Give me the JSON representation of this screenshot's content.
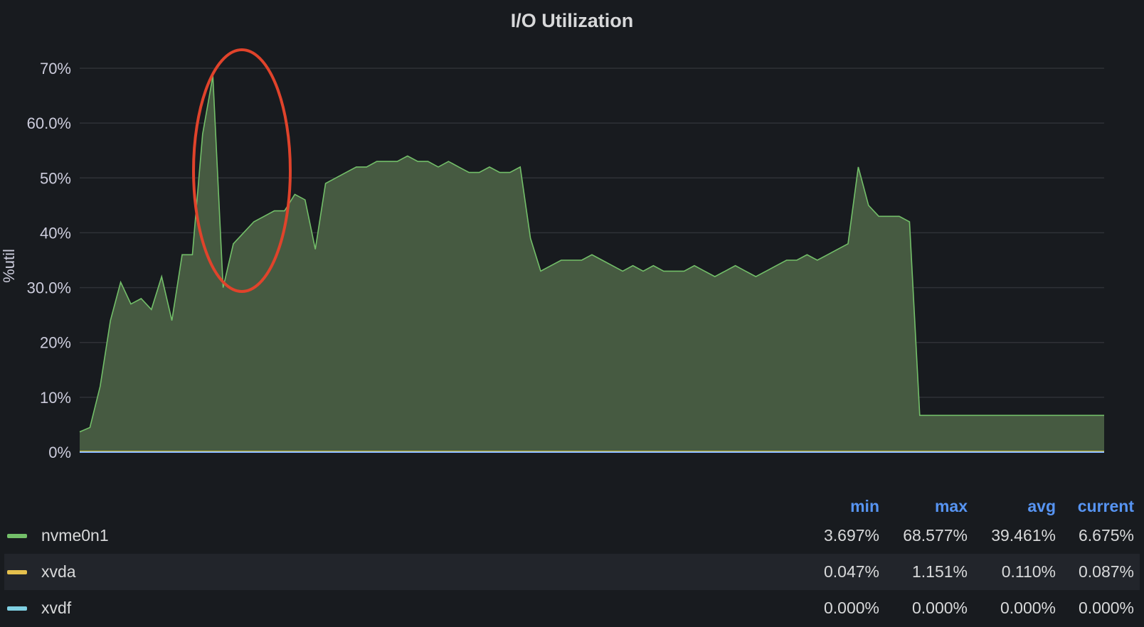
{
  "panel": {
    "title": "I/O Utilization"
  },
  "chart_data": {
    "type": "area",
    "title": "I/O Utilization",
    "ylabel": "%util",
    "ylim": [
      0,
      70
    ],
    "yticks": [
      {
        "value": 0,
        "label": "0%"
      },
      {
        "value": 10,
        "label": "10%"
      },
      {
        "value": 20,
        "label": "20%"
      },
      {
        "value": 30,
        "label": "30.0%"
      },
      {
        "value": 40,
        "label": "40%"
      },
      {
        "value": 50,
        "label": "50%"
      },
      {
        "value": 60,
        "label": "60.0%"
      },
      {
        "value": 70,
        "label": "70%"
      }
    ],
    "grid": true,
    "legend_placement": "bottom",
    "series": [
      {
        "name": "nvme0n1",
        "color": "#73bf69",
        "fill": "#465a41",
        "x": [
          0,
          1,
          2,
          3,
          4,
          5,
          6,
          7,
          8,
          9,
          10,
          11,
          12,
          13,
          14,
          15,
          16,
          17,
          18,
          19,
          20,
          21,
          22,
          23,
          24,
          25,
          26,
          27,
          28,
          29,
          30,
          31,
          32,
          33,
          34,
          35,
          36,
          37,
          38,
          39,
          40,
          41,
          42,
          43,
          44,
          45,
          46,
          47,
          48,
          49,
          50,
          51,
          52,
          53,
          54,
          55,
          56,
          57,
          58,
          59,
          60,
          61,
          62,
          63,
          64,
          65,
          66,
          67,
          68,
          69,
          70,
          71,
          72,
          73,
          74,
          75,
          76,
          77,
          78,
          79,
          80,
          81,
          82,
          83,
          84,
          85,
          86,
          87,
          88,
          89,
          90,
          91,
          92,
          93,
          94,
          95,
          96,
          97,
          98,
          99,
          100
        ],
        "values": [
          3.7,
          4.5,
          12,
          24,
          31,
          27,
          28,
          26,
          32,
          24,
          36,
          36,
          58,
          68.6,
          30,
          38,
          40,
          42,
          43,
          44,
          44,
          47,
          46,
          37,
          49,
          50,
          51,
          52,
          52,
          53,
          53,
          53,
          54,
          53,
          53,
          52,
          53,
          52,
          51,
          51,
          52,
          51,
          51,
          52,
          39,
          33,
          34,
          35,
          35,
          35,
          36,
          35,
          34,
          33,
          34,
          33,
          34,
          33,
          33,
          33,
          34,
          33,
          32,
          33,
          34,
          33,
          32,
          33,
          34,
          35,
          35,
          36,
          35,
          36,
          37,
          38,
          52,
          45,
          43,
          43,
          43,
          42,
          6.7,
          6.7,
          6.7,
          6.7,
          6.7,
          6.7,
          6.7,
          6.7,
          6.7,
          6.7,
          6.7,
          6.7,
          6.7,
          6.7,
          6.7,
          6.7,
          6.7,
          6.7,
          6.7
        ]
      },
      {
        "name": "xvda",
        "color": "#fade2a"
      },
      {
        "name": "xvdf",
        "color": "#8ab8ff"
      }
    ]
  },
  "legend": {
    "headers": {
      "min": "min",
      "max": "max",
      "avg": "avg",
      "current": "current"
    },
    "rows": [
      {
        "name": "nvme0n1",
        "color": "#73bf69",
        "min": "3.697%",
        "max": "68.577%",
        "avg": "39.461%",
        "current": "6.675%"
      },
      {
        "name": "xvda",
        "color": "#e5c04d",
        "min": "0.047%",
        "max": "1.151%",
        "avg": "0.110%",
        "current": "0.087%"
      },
      {
        "name": "xvdf",
        "color": "#7fd0e2",
        "min": "0.000%",
        "max": "0.000%",
        "avg": "0.000%",
        "current": "0.000%"
      }
    ]
  },
  "annotation": {
    "shape": "ellipse",
    "color": "#e0432b"
  }
}
